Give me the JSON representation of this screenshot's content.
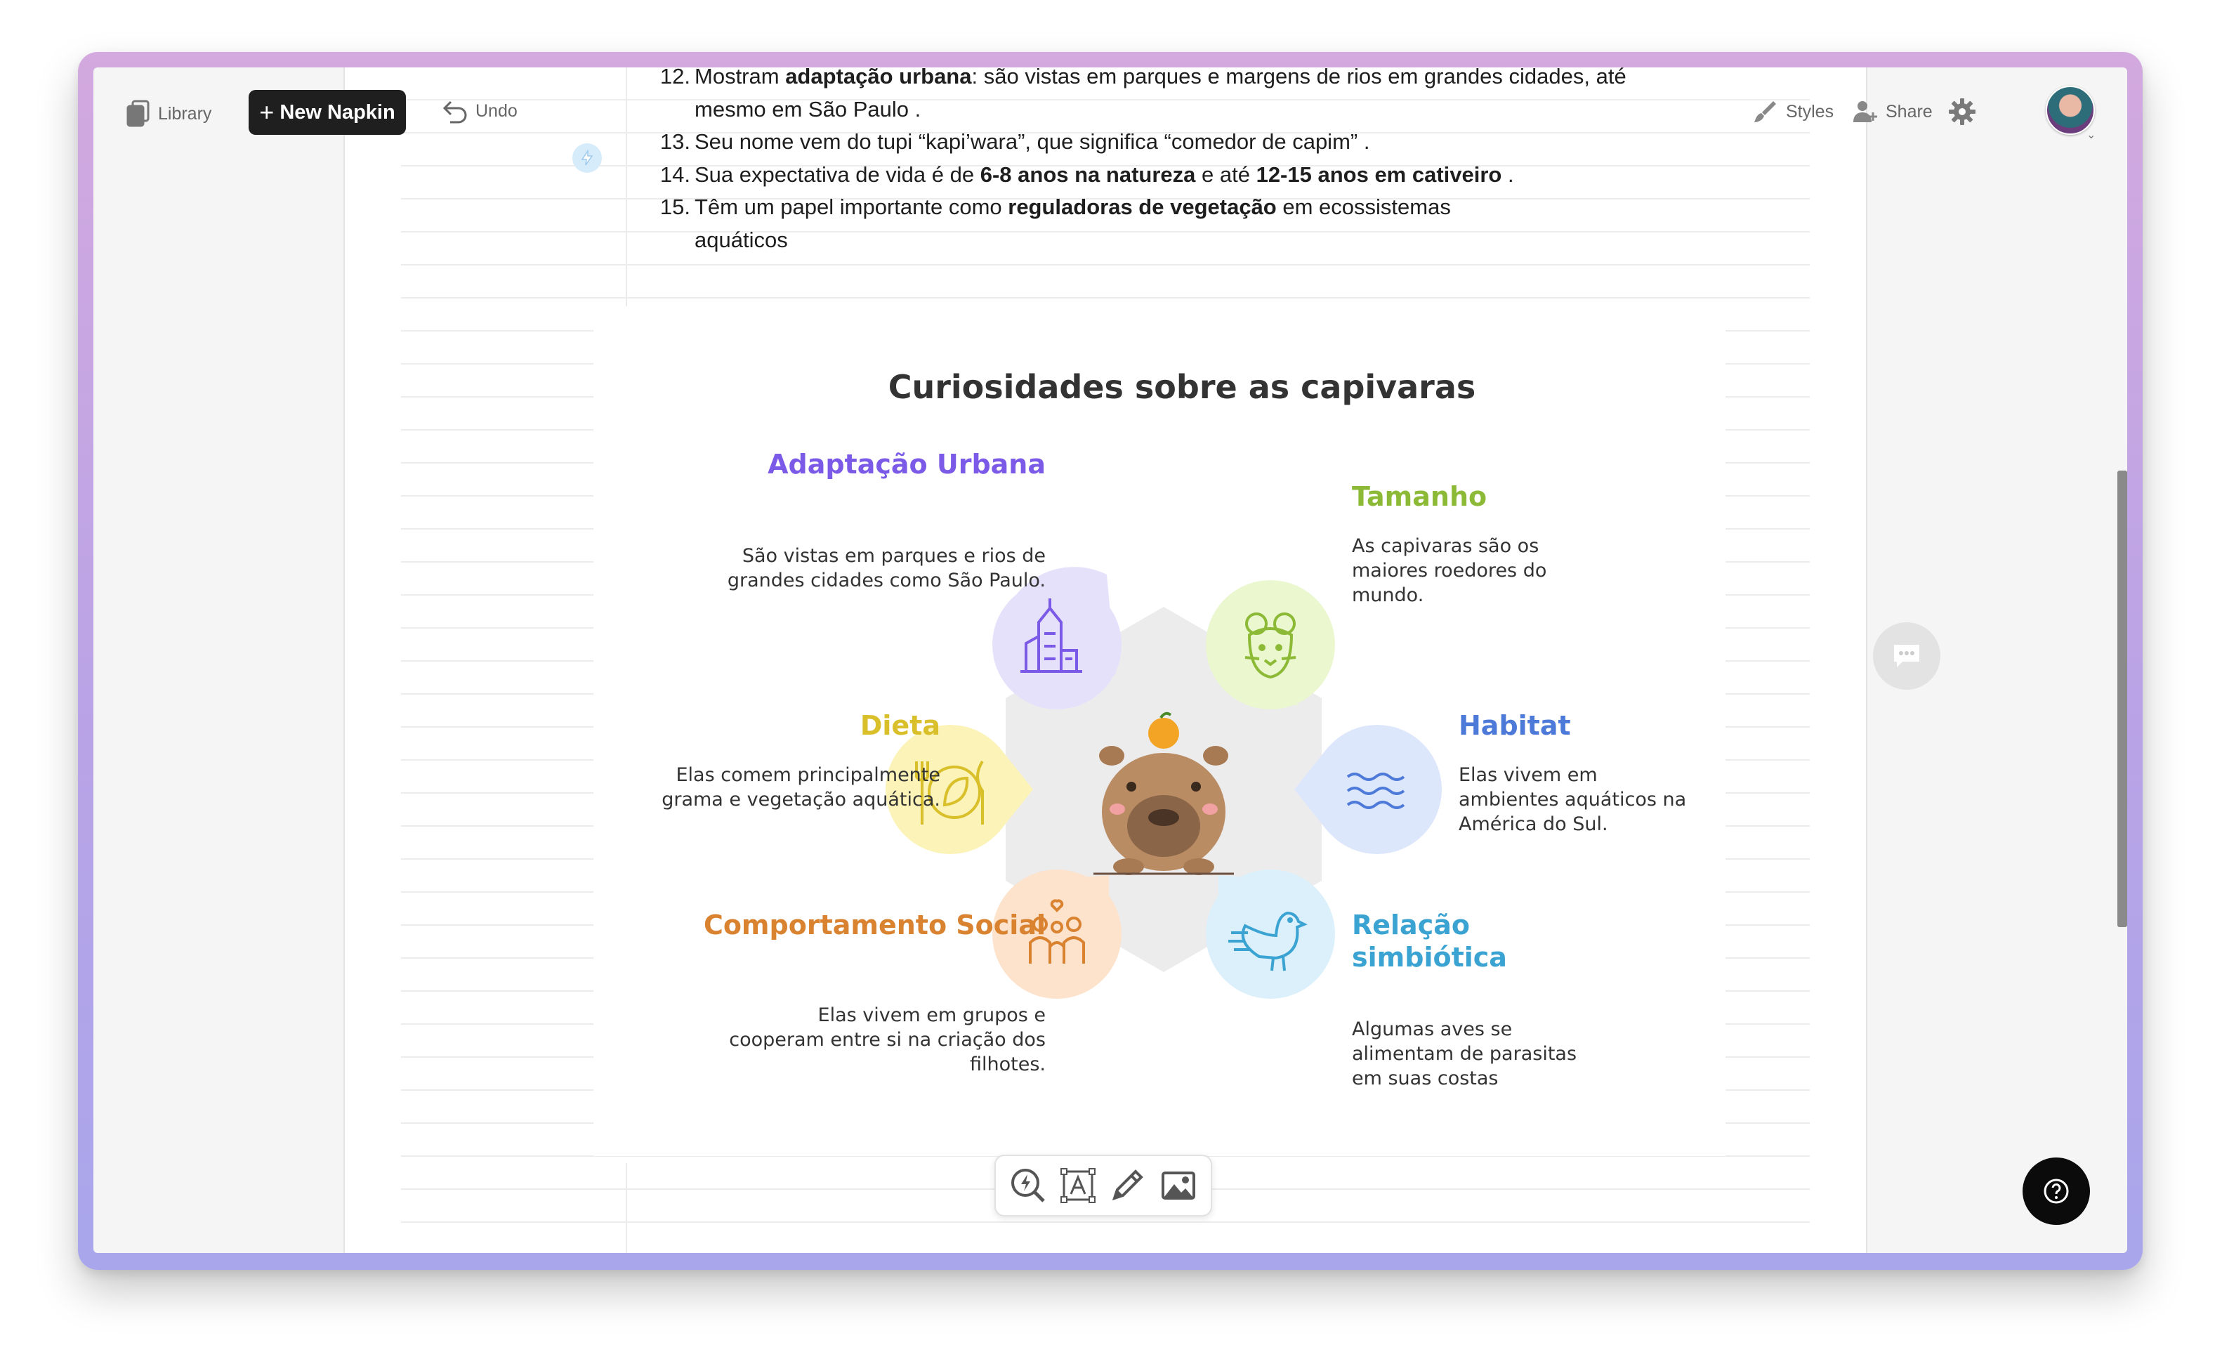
{
  "toolbar": {
    "library_label": "Library",
    "new_napkin_label": "New Napkin",
    "undo_label": "Undo",
    "styles_label": "Styles",
    "share_label": "Share"
  },
  "document": {
    "list": [
      {
        "num": "12.",
        "pre": "Mostram ",
        "bold": "adaptação urbana",
        "post": ": são vistas em parques e margens de rios em grandes cidades, até mesmo em São Paulo  ."
      },
      {
        "num": "13.",
        "pre": "Seu nome vem do tupi “kapi’wara”, que significa “comedor de capim”  .",
        "bold": "",
        "post": ""
      },
      {
        "num": "14.",
        "pre": "Sua expectativa de vida é de ",
        "bold": "6-8 anos na natureza",
        "post": " e até ",
        "bold2": "12-15 anos em cativeiro",
        "post2": "  ."
      },
      {
        "num": "15.",
        "pre": "Têm um papel importante como ",
        "bold": "reguladoras de vegetação",
        "post": " em ecossistemas aquáticos"
      }
    ]
  },
  "graphic": {
    "title": "Curiosidades sobre as capivaras",
    "sections": [
      {
        "id": "adaptacao",
        "title": "Adaptação Urbana",
        "body": "São vistas em parques e rios de grandes cidades como São Paulo.",
        "color": "#7a5ae6",
        "bubble": "#e6e1fb",
        "icon": "city-buildings-icon"
      },
      {
        "id": "tamanho",
        "title": "Tamanho",
        "body": "As capivaras são os maiores roedores do mundo.",
        "color": "#8cba36",
        "bubble": "#eaf7cf",
        "icon": "rodent-face-icon"
      },
      {
        "id": "dieta",
        "title": "Dieta",
        "body": "Elas comem principalmente grama e vegetação aquática.",
        "color": "#d9c02a",
        "bubble": "#fbf3b8",
        "icon": "plate-utensils-leaf-icon"
      },
      {
        "id": "habitat",
        "title": "Habitat",
        "body": "Elas vivem em ambientes aquáticos na América do Sul.",
        "color": "#4d79d8",
        "bubble": "#dde7fb",
        "icon": "water-waves-icon"
      },
      {
        "id": "comportamento",
        "title": "Comportamento Social",
        "body": "Elas vivem em grupos e cooperam entre si na criação dos filhotes.",
        "color": "#d9822f",
        "bubble": "#fde2cc",
        "icon": "family-group-icon"
      },
      {
        "id": "relacao",
        "title": "Relação simbiótica",
        "body": "Algumas aves se alimentam de parasitas em suas costas",
        "color": "#3aa3d1",
        "bubble": "#dbf0fb",
        "icon": "bird-icon"
      }
    ]
  }
}
